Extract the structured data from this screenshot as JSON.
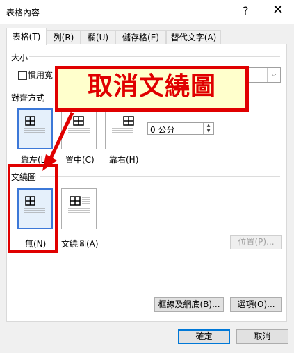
{
  "window": {
    "title": "表格內容",
    "help_glyph": "?",
    "close_glyph": "✕"
  },
  "tabs": [
    {
      "label": "表格(T)",
      "active": true
    },
    {
      "label": "列(R)",
      "active": false
    },
    {
      "label": "欄(U)",
      "active": false
    },
    {
      "label": "儲存格(E)",
      "active": false
    },
    {
      "label": "替代文字(A)",
      "active": false
    }
  ],
  "size_section": {
    "heading": "大小",
    "preferred_width_label": "慣用寬",
    "preferred_width_checked": false
  },
  "alignment_section": {
    "heading": "對齊方式",
    "options": [
      {
        "label": "靠左(L)",
        "selected": true
      },
      {
        "label": "置中(C)",
        "selected": false
      },
      {
        "label": "靠右(H)",
        "selected": false
      }
    ],
    "indent_value": "0 公分"
  },
  "wrap_section": {
    "heading": "文繞圖",
    "options": [
      {
        "label": "無(N)",
        "selected": true
      },
      {
        "label": "文繞圖(A)",
        "selected": false
      }
    ],
    "position_button": "位置(P)..."
  },
  "footer_buttons": {
    "borders": "框線及網底(B)...",
    "options": "選項(O)...",
    "ok": "確定",
    "cancel": "取消"
  },
  "annotation": {
    "text": "取消文繞圖",
    "color": "#e00000",
    "fill": "#ffffcc"
  },
  "colors": {
    "selection_border": "#3c78d8",
    "selection_fill": "#e5f0fb",
    "primary_button_border": "#0078d7"
  }
}
